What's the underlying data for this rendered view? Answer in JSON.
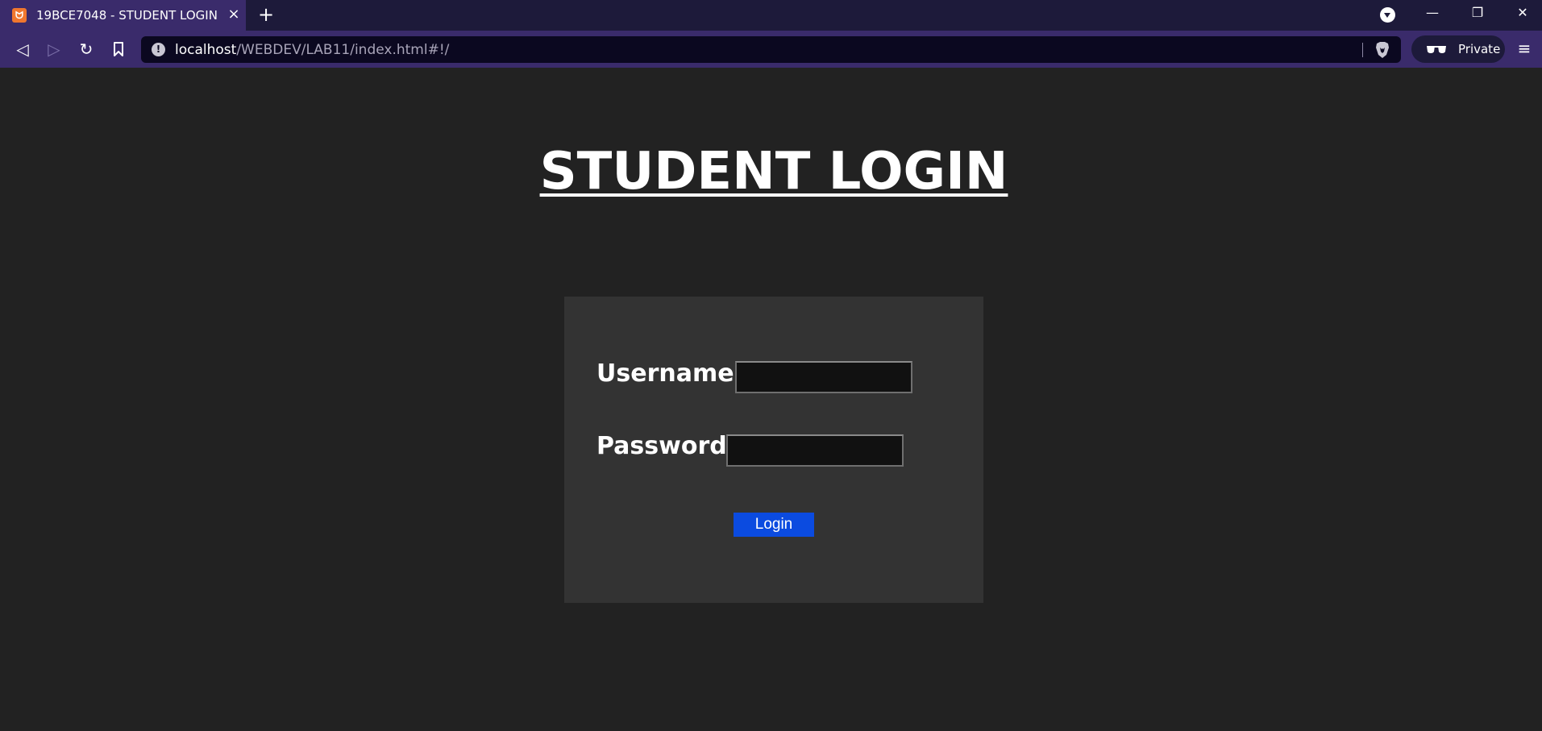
{
  "browser": {
    "tab": {
      "title": "19BCE7048 - STUDENT LOGIN",
      "favicon": "xampp-icon",
      "close": "×"
    },
    "new_tab": "+",
    "window_controls": {
      "minimize": "—",
      "restore": "❐",
      "close": "✕"
    },
    "toolbar": {
      "back": "◁",
      "forward": "▷",
      "reload": "↻",
      "bookmark": "🔖"
    },
    "address": {
      "host": "localhost",
      "path": "/WEBDEV/LAB11/index.html#!/",
      "info_icon": "!"
    },
    "private_label": "Private",
    "menu": "≡",
    "colors": {
      "titlebar": "#1d1a3a",
      "toolbar": "#3a2b6b",
      "urlbar": "#0b0820"
    }
  },
  "page": {
    "title": "STUDENT LOGIN",
    "form": {
      "username_label": "Username :",
      "username_value": "",
      "password_label": "Password :",
      "password_value": "",
      "login_label": "Login"
    },
    "colors": {
      "background": "#222222",
      "card": "#333333",
      "button": "#0b4be0"
    }
  }
}
